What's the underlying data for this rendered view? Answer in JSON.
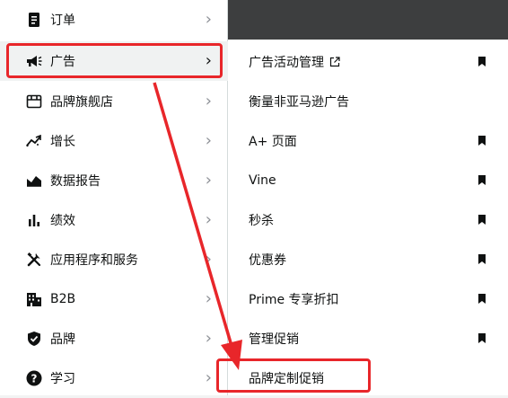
{
  "menu": {
    "items": [
      {
        "label": "订单",
        "icon": "order-icon"
      },
      {
        "label": "广告",
        "icon": "megaphone-icon"
      },
      {
        "label": "品牌旗舰店",
        "icon": "storefront-icon"
      },
      {
        "label": "增长",
        "icon": "growth-icon"
      },
      {
        "label": "数据报告",
        "icon": "report-chart-icon"
      },
      {
        "label": "绩效",
        "icon": "bar-chart-icon"
      },
      {
        "label": "应用程序和服务",
        "icon": "tools-icon"
      },
      {
        "label": "B2B",
        "icon": "building-icon"
      },
      {
        "label": "品牌",
        "icon": "shield-check-icon"
      },
      {
        "label": "学习",
        "icon": "help-icon"
      }
    ],
    "chevron": "›"
  },
  "submenu": {
    "items": [
      {
        "label": "广告活动管理",
        "external": true,
        "bookmark": true
      },
      {
        "label": "衡量非亚马逊广告",
        "external": false,
        "bookmark": false
      },
      {
        "label": "A+ 页面",
        "external": false,
        "bookmark": true
      },
      {
        "label": "Vine",
        "external": false,
        "bookmark": true
      },
      {
        "label": "秒杀",
        "external": false,
        "bookmark": true
      },
      {
        "label": "优惠券",
        "external": false,
        "bookmark": true
      },
      {
        "label": "Prime 专享折扣",
        "external": false,
        "bookmark": true
      },
      {
        "label": "管理促销",
        "external": false,
        "bookmark": true
      },
      {
        "label": "品牌定制促销",
        "external": false,
        "bookmark": false
      }
    ]
  },
  "colors": {
    "highlight": "#e8262a",
    "topbar": "#3d3e3f"
  }
}
